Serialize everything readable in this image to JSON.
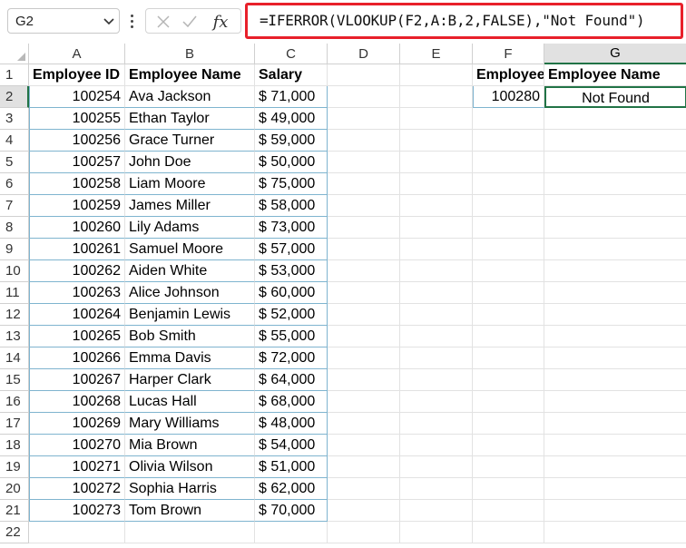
{
  "formula_bar": {
    "name_box": "G2",
    "fx_label": "fx",
    "formula": "=IFERROR(VLOOKUP(F2,A:B,2,FALSE),\"Not Found\")"
  },
  "columns": [
    "A",
    "B",
    "C",
    "D",
    "E",
    "F",
    "G"
  ],
  "rows": [
    "1",
    "2",
    "3",
    "4",
    "5",
    "6",
    "7",
    "8",
    "9",
    "10",
    "11",
    "12",
    "13",
    "14",
    "15",
    "16",
    "17",
    "18",
    "19",
    "20",
    "21",
    "22"
  ],
  "table": {
    "headers": [
      "Employee ID",
      "Employee Name",
      "Salary"
    ],
    "data": [
      [
        "100254",
        "Ava Jackson",
        "$ 71,000"
      ],
      [
        "100255",
        "Ethan Taylor",
        "$ 49,000"
      ],
      [
        "100256",
        "Grace Turner",
        "$ 59,000"
      ],
      [
        "100257",
        "John Doe",
        "$ 50,000"
      ],
      [
        "100258",
        "Liam Moore",
        "$ 75,000"
      ],
      [
        "100259",
        "James Miller",
        "$ 58,000"
      ],
      [
        "100260",
        "Lily Adams",
        "$ 73,000"
      ],
      [
        "100261",
        "Samuel Moore",
        "$ 57,000"
      ],
      [
        "100262",
        "Aiden White",
        "$ 53,000"
      ],
      [
        "100263",
        "Alice Johnson",
        "$ 60,000"
      ],
      [
        "100264",
        "Benjamin Lewis",
        "$ 52,000"
      ],
      [
        "100265",
        "Bob Smith",
        "$ 55,000"
      ],
      [
        "100266",
        "Emma Davis",
        "$ 72,000"
      ],
      [
        "100267",
        "Harper Clark",
        "$ 64,000"
      ],
      [
        "100268",
        "Lucas Hall",
        "$ 68,000"
      ],
      [
        "100269",
        "Mary Williams",
        "$ 48,000"
      ],
      [
        "100270",
        "Mia Brown",
        "$ 54,000"
      ],
      [
        "100271",
        "Olivia Wilson",
        "$ 51,000"
      ],
      [
        "100272",
        "Sophia Harris",
        "$ 62,000"
      ],
      [
        "100273",
        "Tom Brown",
        "$ 70,000"
      ]
    ]
  },
  "lookup": {
    "headers": [
      "Employee",
      "Employee Name"
    ],
    "values": [
      "100280",
      "Not Found"
    ]
  },
  "colors": {
    "highlight_border": "#e8202a",
    "selection": "#217346",
    "table_border": "#7fb4cf"
  },
  "icons": {
    "name_box_caret": "chevron-down-icon",
    "cancel": "x-icon",
    "enter": "check-icon"
  }
}
